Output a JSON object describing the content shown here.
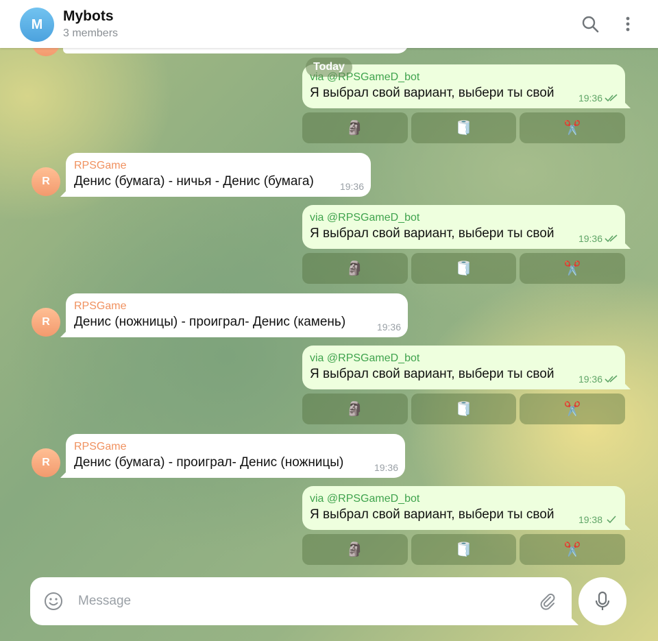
{
  "header": {
    "avatar_letter": "M",
    "title": "Mybots",
    "subtitle": "3 members",
    "icons": [
      "search-icon",
      "more-vertical-icon"
    ]
  },
  "date_chip": "Today",
  "keyboard": {
    "rock": "🗿",
    "paper": "🧻",
    "scissors": "✂️"
  },
  "messages": [
    {
      "type": "out",
      "via": "via @RPSGameD_bot",
      "text": "Я выбрал свой вариант, выбери ты свой",
      "time": "19:36",
      "status": "read"
    },
    {
      "type": "in",
      "avatar": "R",
      "sender": "RPSGame",
      "text": "Денис (бумага) - ничья - Денис (бумага)",
      "time": "19:36"
    },
    {
      "type": "out",
      "via": "via @RPSGameD_bot",
      "text": "Я выбрал свой вариант, выбери ты свой",
      "time": "19:36",
      "status": "read"
    },
    {
      "type": "in",
      "avatar": "R",
      "sender": "RPSGame",
      "text": "Денис (ножницы) - проиграл- Денис (камень)",
      "time": "19:36"
    },
    {
      "type": "out",
      "via": "via @RPSGameD_bot",
      "text": "Я выбрал свой вариант, выбери ты свой",
      "time": "19:36",
      "status": "read"
    },
    {
      "type": "in",
      "avatar": "R",
      "sender": "RPSGame",
      "text": "Денис (бумага) - проиграл- Денис (ножницы)",
      "time": "19:36"
    },
    {
      "type": "out",
      "via": "via @RPSGameD_bot",
      "text": "Я выбрал свой вариант, выбери ты свой",
      "time": "19:38",
      "status": "sent"
    }
  ],
  "composer": {
    "placeholder": "Message"
  },
  "colors": {
    "accent": "#3fa34d",
    "sender": "#f0915f",
    "out_bubble": "#eeffde"
  }
}
